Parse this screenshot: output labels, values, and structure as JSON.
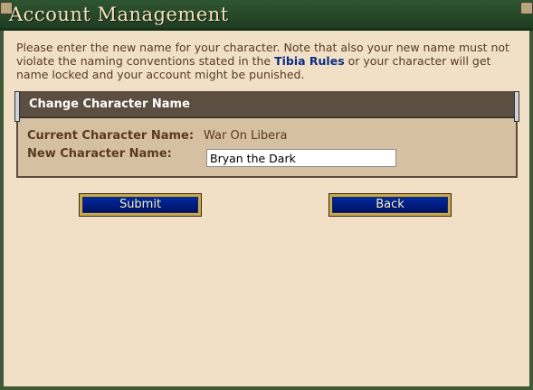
{
  "header": {
    "title": "Account Management"
  },
  "intro": {
    "text_before": "Please enter the new name for your character. Note that also your new name must not violate the naming conventions stated in the ",
    "link": "Tibia Rules",
    "text_after": " or your character will get name locked and your account might be punished."
  },
  "form": {
    "title": "Change Character Name",
    "current_label": "Current Character Name:",
    "current_value": "War On Libera",
    "new_label": "New Character Name:",
    "new_value": "Bryan the Dark"
  },
  "buttons": {
    "submit": "Submit",
    "back": "Back"
  },
  "colors": {
    "header_bg": "#2f5530",
    "page_bg": "#f1e0c6",
    "button_bg": "#0029a0",
    "button_border": "#c7a94f",
    "link": "#0c2d85"
  }
}
